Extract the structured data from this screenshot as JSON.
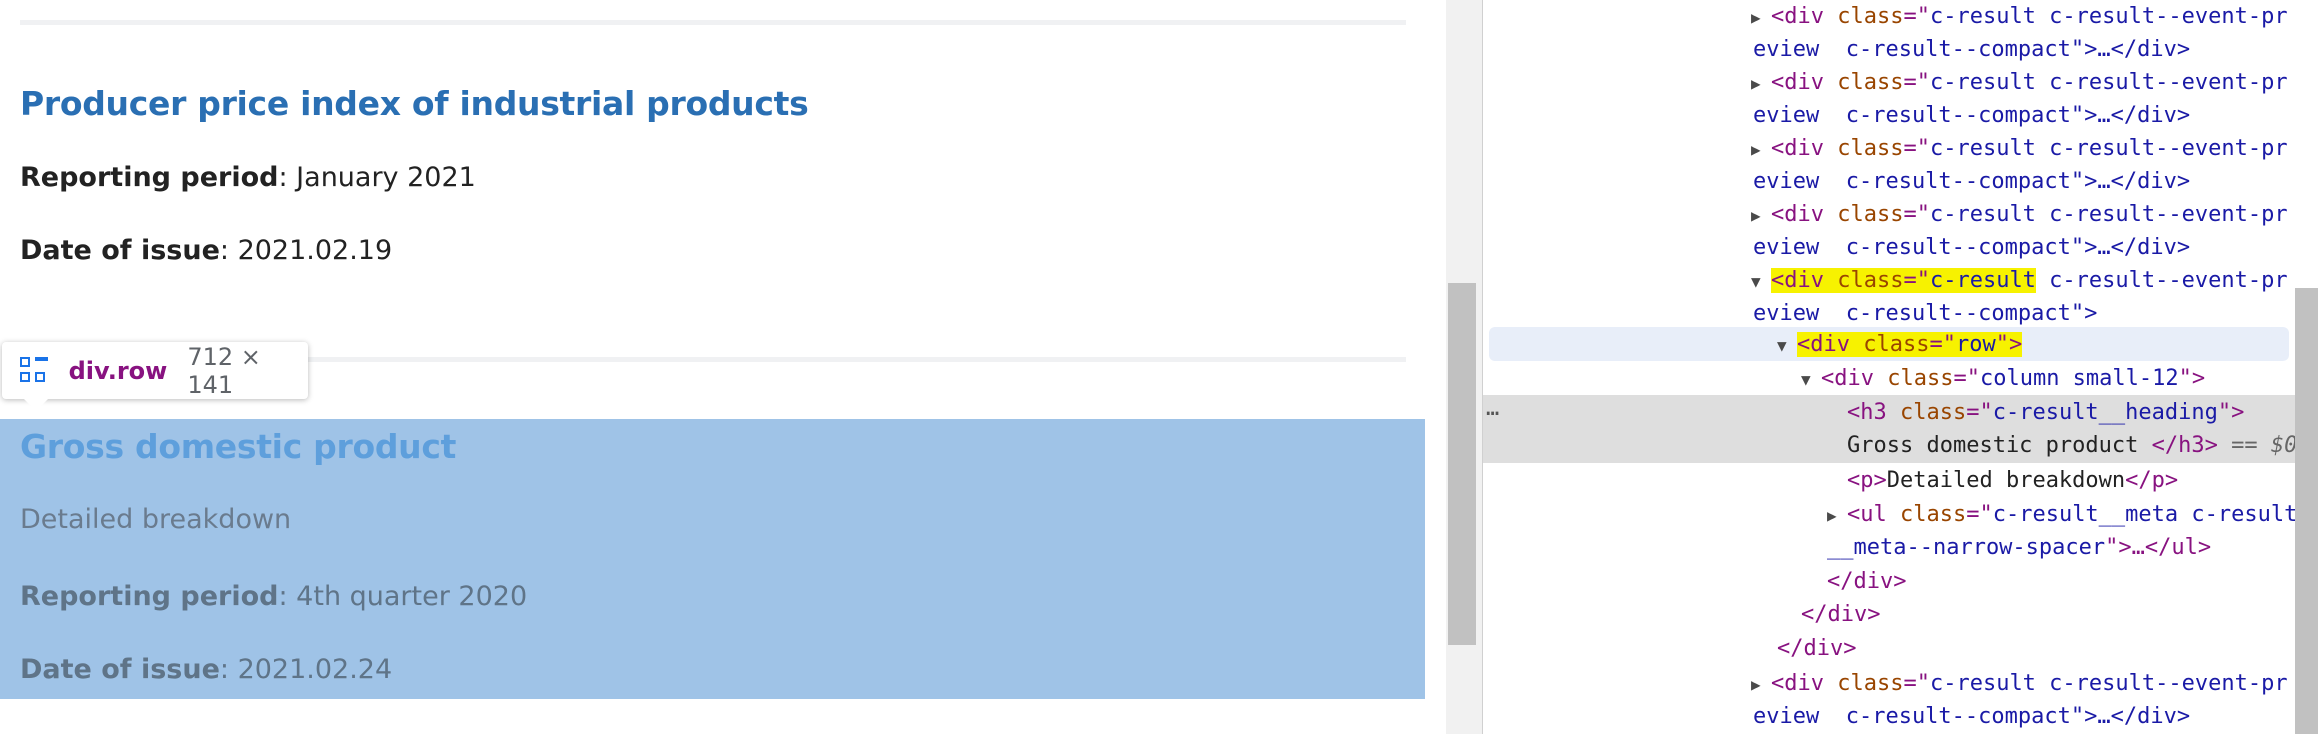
{
  "results": [
    {
      "title": "Producer price index of industrial products",
      "reporting_label": "Reporting period",
      "reporting_value": ": January 2021",
      "issue_label": "Date of issue",
      "issue_value": ": 2021.02.19"
    },
    {
      "title": "Gross domestic product",
      "description": "Detailed breakdown",
      "reporting_label": "Reporting period",
      "reporting_value": ": 4th quarter 2020",
      "issue_label": "Date of issue",
      "issue_value": ": 2021.02.24"
    }
  ],
  "tooltip": {
    "name": "div.row",
    "size": "712 × 141"
  },
  "devtools": {
    "compact_line_a": "<div class=\"c-result c-result--event-pr",
    "compact_line_b": "eview  c-result--compact\">…</div>",
    "open_div": "<div",
    "class_attr": "class",
    "eq_quote": "=\"",
    "class_c_result": "c-result",
    "class_rest_a": " c-result--event-pr",
    "open_line_b": "eview  c-result--compact\">",
    "row_open": "<div ",
    "row_attr": "class",
    "row_eq": "=\"",
    "row_val": "row",
    "row_close": "\">",
    "col_open": "<div ",
    "col_attr": "class",
    "col_eq": "=\"",
    "col_val": "column small-12",
    "col_close": "\">",
    "h3_open": "<h3 ",
    "h3_attr": "class",
    "h3_eq": "=\"",
    "h3_val": "c-result__heading",
    "h3_close": "\">",
    "h3_text": "Gross domestic product ",
    "h3_end": "</h3>",
    "h3_eqsign": " == $0",
    "p_open": "<p>",
    "p_text": "Detailed breakdown",
    "p_close": "</p>",
    "ul_open": "<ul ",
    "ul_attr": "class",
    "ul_eq": "=\"",
    "ul_val_a": "c-result__meta c-result",
    "ul_val_b": "__meta--narrow-spacer",
    "ul_rest": "\">…</ul>",
    "close_div": "</div>",
    "dots": "…"
  },
  "colors": {
    "heading_link": "#2a6fb3",
    "highlight": "#9fc3e7",
    "tag": "#881280",
    "attribute": "#994500",
    "value": "#1a1aa6",
    "marker": "#f7f200"
  },
  "icons": [
    "grid-icon",
    "expand-triangle-icon",
    "collapse-triangle-icon",
    "ellipsis-icon"
  ]
}
